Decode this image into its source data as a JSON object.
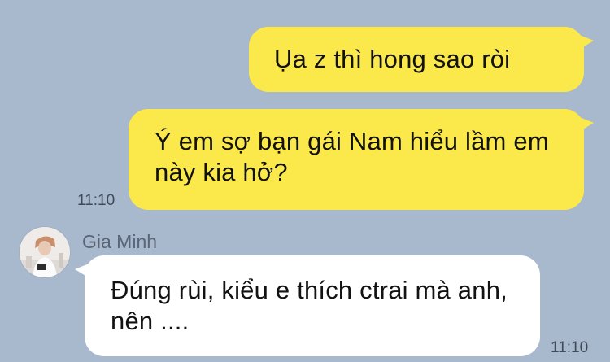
{
  "colors": {
    "background": "#a9b9cd",
    "outgoing_bubble": "#fbe94c",
    "incoming_bubble": "#ffffff",
    "text": "#121212",
    "timestamp": "#3f4a57",
    "sender_name": "#5a6576"
  },
  "messages": [
    {
      "direction": "outgoing",
      "text": "Ụa z thì hong sao ròi"
    },
    {
      "direction": "outgoing",
      "text": "Ý em sợ bạn gái Nam hiểu lầm em này kia hở?",
      "time": "11:10"
    },
    {
      "direction": "incoming",
      "sender": "Gia Minh",
      "avatar_icon": "contact-avatar",
      "text": "Đúng rùi, kiểu e thích ctrai mà anh, nên ....",
      "time": "11:10"
    }
  ]
}
